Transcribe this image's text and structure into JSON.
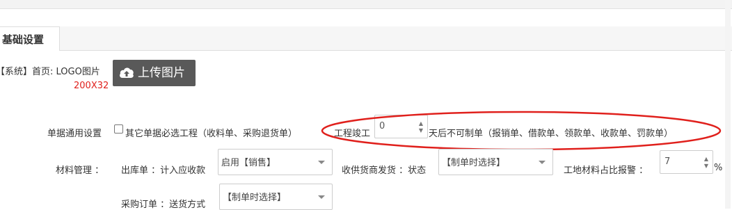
{
  "tabs": [
    {
      "label": "基础设置"
    }
  ],
  "logo": {
    "label": "【系统】首页: LOGO图片",
    "size_hint": "200X32",
    "upload_button": "上传图片"
  },
  "doc_settings": {
    "label": "单据通用设置",
    "checkbox_label": "其它单据必选工程（收料单、采购退货单）",
    "project_done_label": "工程竣工",
    "days_value": "0",
    "days_suffix": "天后不可制单（报销单、借款单、领款单、收款单、罚款单）"
  },
  "material": {
    "label": "材料管理 ：",
    "outbound_label": "出库单 ：计入应收款",
    "outbound_value": "启用【销售】",
    "supplier_label": "收供货商发货 ：状态",
    "supplier_value": "【制单时选择】",
    "alarm_label": "工地材料占比报警 ：",
    "alarm_value": "7",
    "alarm_unit": "%"
  },
  "purchase": {
    "label": "采购订单 ：送货方式",
    "value": "【制单时选择】"
  },
  "colors": {
    "annotation": "#e0201c",
    "upload_bg": "#595959"
  }
}
